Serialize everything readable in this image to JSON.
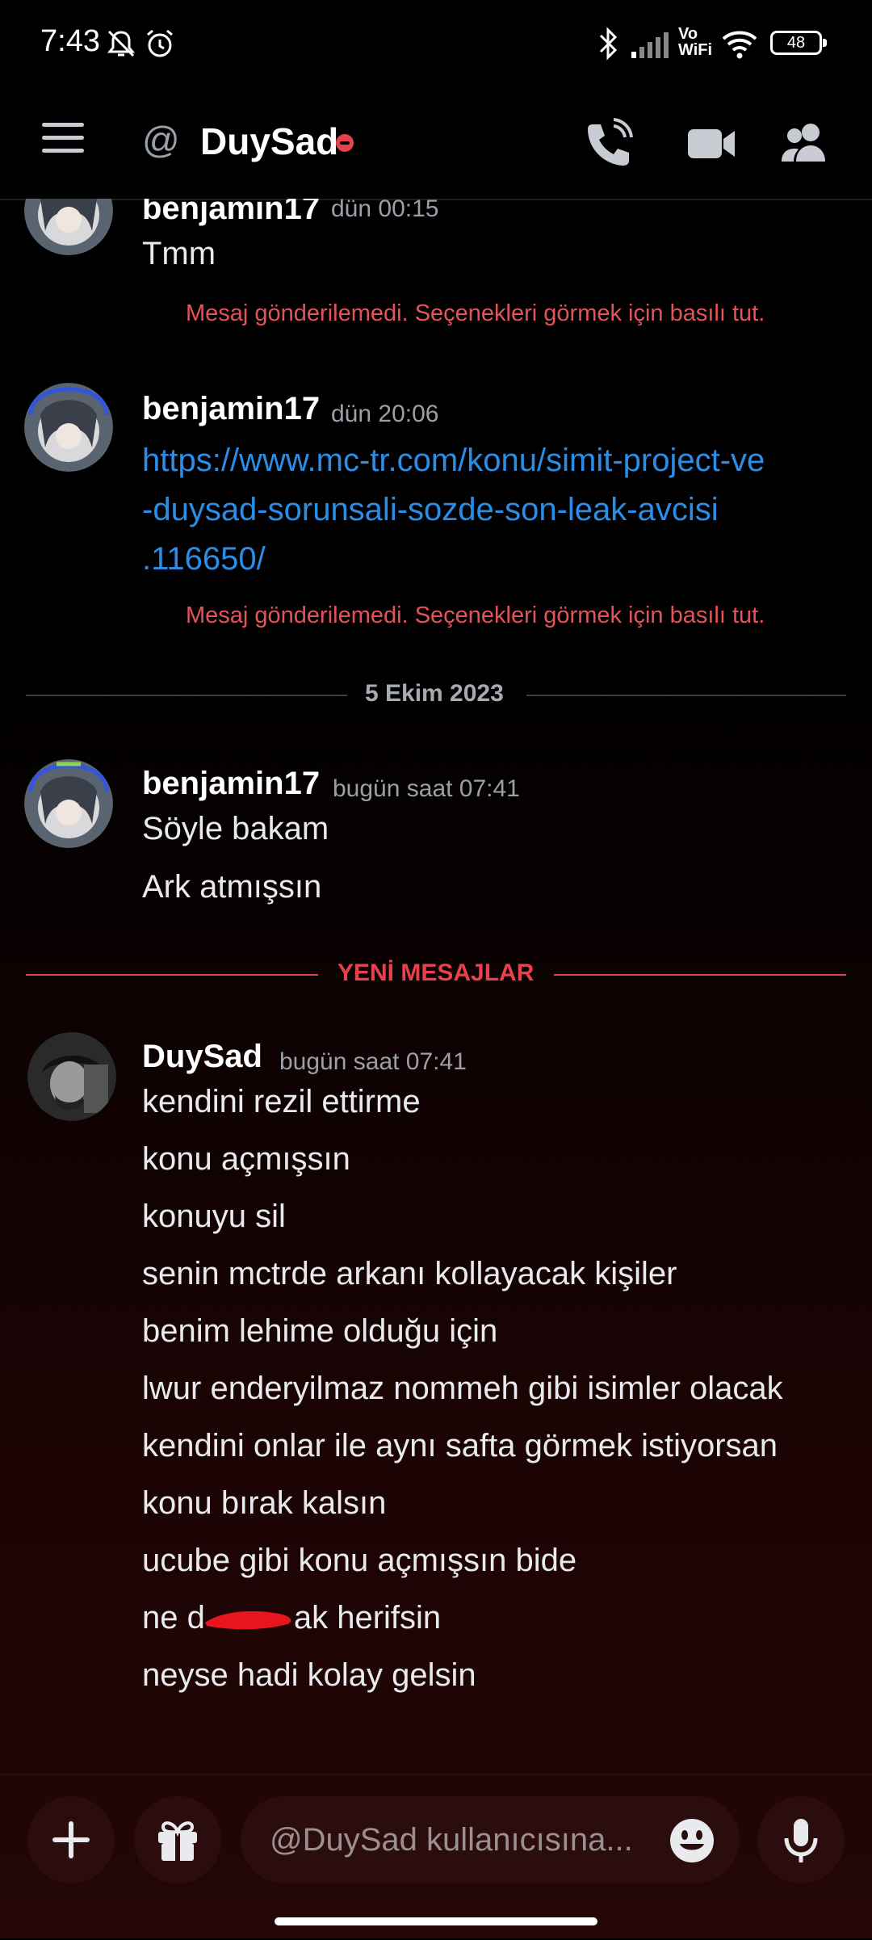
{
  "status_bar": {
    "time": "7:43",
    "icons": [
      "bell-off-icon",
      "alarm-icon",
      "bluetooth-icon",
      "signal-icon",
      "vowifi-icon",
      "wifi-icon",
      "battery-icon"
    ],
    "vowifi_label": "Vo WiFi",
    "battery": "48"
  },
  "header": {
    "title": "DuySad",
    "icons": [
      "menu-icon",
      "at-icon",
      "dnd-status-icon",
      "voice-call-icon",
      "video-call-icon",
      "members-icon"
    ]
  },
  "messages": [
    {
      "author": "benjamin17",
      "timestamp": "dün 00:15",
      "lines": [
        "Tmm"
      ],
      "error": "Mesaj gönderilemedi. Seçenekleri görmek için basılı tut."
    },
    {
      "author": "benjamin17",
      "timestamp": "dün 20:06",
      "link_lines": [
        "https://www.mc-tr.com/konu/simit-project-ve",
        "-duysad-sorunsali-sozde-son-leak-avcisi",
        ".116650/"
      ],
      "error": "Mesaj gönderilemedi. Seçenekleri görmek için basılı tut."
    },
    {
      "author": "benjamin17",
      "timestamp": "bugün saat 07:41",
      "lines": [
        "Söyle bakam",
        "Ark atmışsın"
      ]
    },
    {
      "author": "DuySad",
      "timestamp": "bugün saat 07:41",
      "lines": [
        "kendini rezil ettirme",
        "konu açmışsın",
        "konuyu sil",
        "senin mctrde arkanı kollayacak kişiler",
        "benim lehime olduğu için",
        "lwur enderyilmaz nommeh gibi isimler olacak",
        "kendini onlar ile aynı safta görmek istiyorsan",
        "konu bırak kalsın",
        "ucube gibi konu açmışsın bide",
        "ne d",
        "ak herifsin",
        "neyse hadi kolay gelsin"
      ]
    }
  ],
  "dividers": {
    "date": "5 Ekim 2023",
    "new_messages": "YENİ MESAJLAR"
  },
  "composer": {
    "placeholder": "@DuySad kullanıcısına...",
    "icons": [
      "plus-icon",
      "gift-icon",
      "emoji-icon",
      "microphone-icon"
    ]
  },
  "colors": {
    "link": "#2b8ee6",
    "error": "#e4535a",
    "new_messages": "#e8414b",
    "background_bottom": "#240606"
  }
}
